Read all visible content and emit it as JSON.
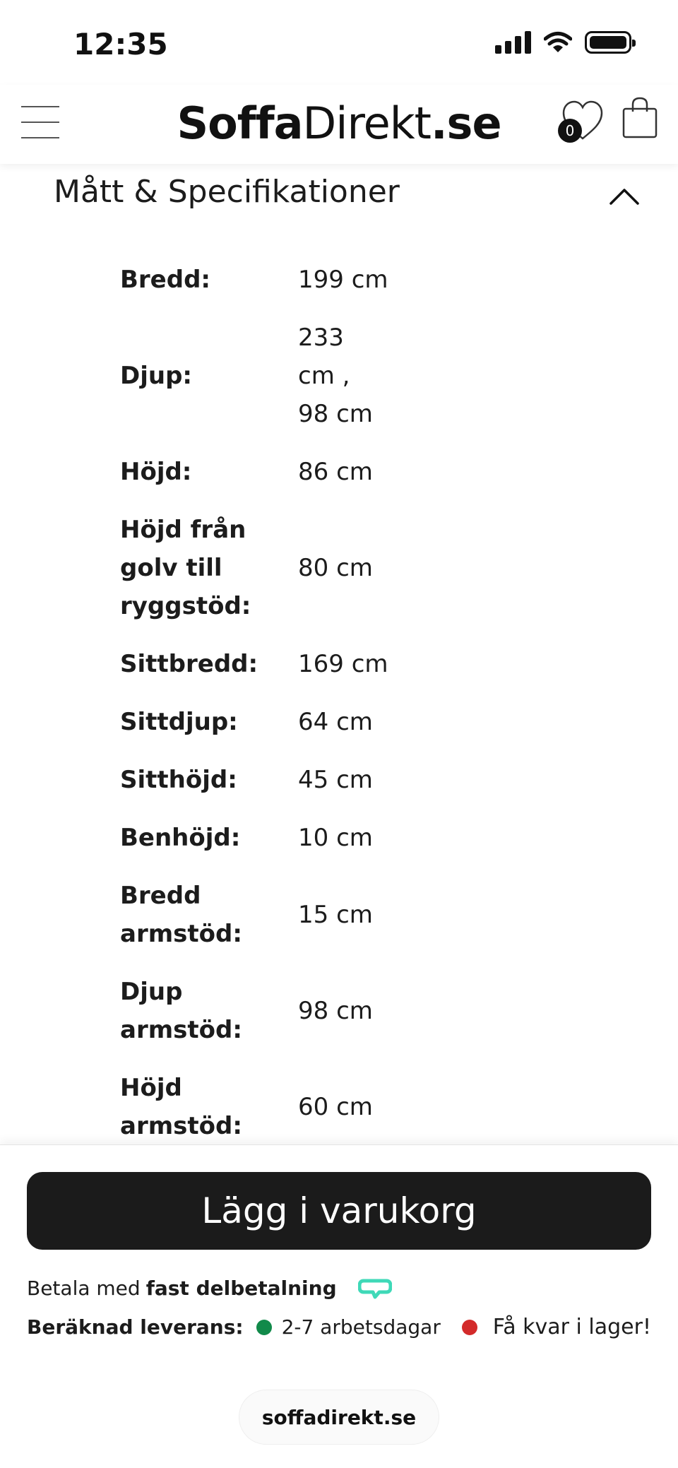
{
  "status_bar": {
    "time": "12:35"
  },
  "header": {
    "logo_bold": "Soffa",
    "logo_regular": "Direkt",
    "logo_suffix": ".se",
    "wishlist_count": "0"
  },
  "section": {
    "title": "Mått & Specifikationer"
  },
  "specs": [
    {
      "label": "Bredd:",
      "value": "199 cm"
    },
    {
      "label": "Djup:",
      "value": "233 cm , 98 cm"
    },
    {
      "label": "Höjd:",
      "value": "86 cm"
    },
    {
      "label": "Höjd från golv till ryggstöd:",
      "value": "80 cm"
    },
    {
      "label": "Sittbredd:",
      "value": "169 cm"
    },
    {
      "label": "Sittdjup:",
      "value": "64 cm"
    },
    {
      "label": "Sitthöjd:",
      "value": "45 cm"
    },
    {
      "label": "Benhöjd:",
      "value": "10 cm"
    },
    {
      "label": "Bredd armstöd:",
      "value": "15 cm"
    },
    {
      "label": "Djup armstöd:",
      "value": "98 cm"
    },
    {
      "label": "Höjd armstöd:",
      "value": "60 cm"
    }
  ],
  "bottom": {
    "cart_button": "Lägg i varukorg",
    "pay_prefix": "Betala med",
    "pay_strong": "fast delbetalning",
    "delivery_label": "Beräknad leverans:",
    "delivery_value": "2-7 arbetsdagar",
    "stock_text": "Få kvar i lager!",
    "url": "soffadirekt.se"
  },
  "colors": {
    "green": "#118a4a",
    "red": "#d32a2a",
    "klarna": "#3fd9b8",
    "button": "#1b1b1b"
  }
}
